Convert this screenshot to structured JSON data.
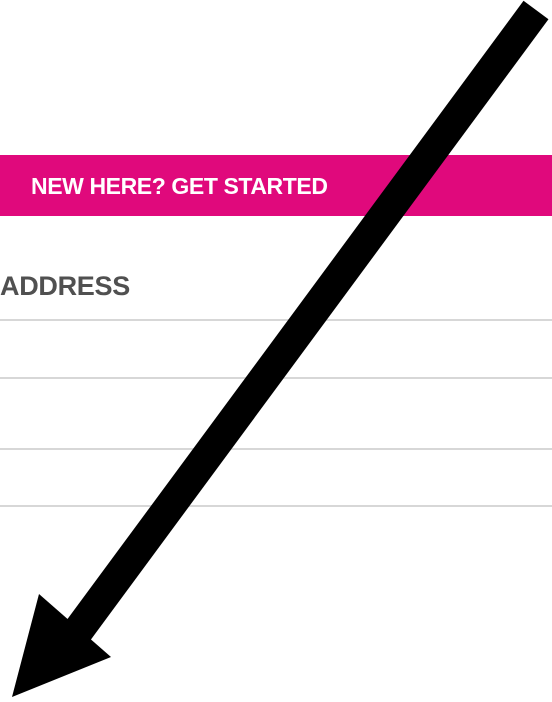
{
  "banner": {
    "label": "NEW HERE? GET STARTED",
    "color": "#e0097c"
  },
  "address_section": {
    "heading": "ADDRESS"
  },
  "overlay": {
    "icon": "arrow-pointing-down-left",
    "color": "#000000"
  }
}
